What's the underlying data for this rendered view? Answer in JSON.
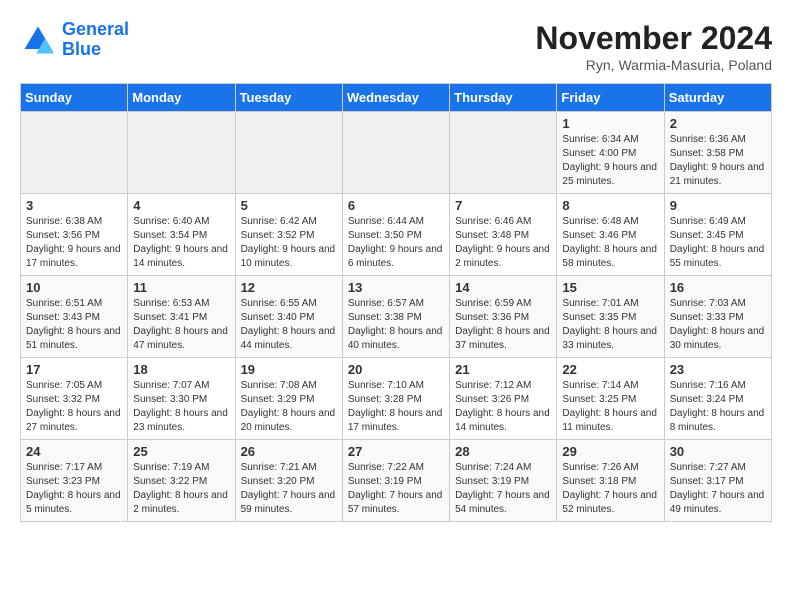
{
  "header": {
    "logo_line1": "General",
    "logo_line2": "Blue",
    "month": "November 2024",
    "location": "Ryn, Warmia-Masuria, Poland"
  },
  "days_of_week": [
    "Sunday",
    "Monday",
    "Tuesday",
    "Wednesday",
    "Thursday",
    "Friday",
    "Saturday"
  ],
  "weeks": [
    [
      {
        "day": "",
        "info": ""
      },
      {
        "day": "",
        "info": ""
      },
      {
        "day": "",
        "info": ""
      },
      {
        "day": "",
        "info": ""
      },
      {
        "day": "",
        "info": ""
      },
      {
        "day": "1",
        "info": "Sunrise: 6:34 AM\nSunset: 4:00 PM\nDaylight: 9 hours and 25 minutes."
      },
      {
        "day": "2",
        "info": "Sunrise: 6:36 AM\nSunset: 3:58 PM\nDaylight: 9 hours and 21 minutes."
      }
    ],
    [
      {
        "day": "3",
        "info": "Sunrise: 6:38 AM\nSunset: 3:56 PM\nDaylight: 9 hours and 17 minutes."
      },
      {
        "day": "4",
        "info": "Sunrise: 6:40 AM\nSunset: 3:54 PM\nDaylight: 9 hours and 14 minutes."
      },
      {
        "day": "5",
        "info": "Sunrise: 6:42 AM\nSunset: 3:52 PM\nDaylight: 9 hours and 10 minutes."
      },
      {
        "day": "6",
        "info": "Sunrise: 6:44 AM\nSunset: 3:50 PM\nDaylight: 9 hours and 6 minutes."
      },
      {
        "day": "7",
        "info": "Sunrise: 6:46 AM\nSunset: 3:48 PM\nDaylight: 9 hours and 2 minutes."
      },
      {
        "day": "8",
        "info": "Sunrise: 6:48 AM\nSunset: 3:46 PM\nDaylight: 8 hours and 58 minutes."
      },
      {
        "day": "9",
        "info": "Sunrise: 6:49 AM\nSunset: 3:45 PM\nDaylight: 8 hours and 55 minutes."
      }
    ],
    [
      {
        "day": "10",
        "info": "Sunrise: 6:51 AM\nSunset: 3:43 PM\nDaylight: 8 hours and 51 minutes."
      },
      {
        "day": "11",
        "info": "Sunrise: 6:53 AM\nSunset: 3:41 PM\nDaylight: 8 hours and 47 minutes."
      },
      {
        "day": "12",
        "info": "Sunrise: 6:55 AM\nSunset: 3:40 PM\nDaylight: 8 hours and 44 minutes."
      },
      {
        "day": "13",
        "info": "Sunrise: 6:57 AM\nSunset: 3:38 PM\nDaylight: 8 hours and 40 minutes."
      },
      {
        "day": "14",
        "info": "Sunrise: 6:59 AM\nSunset: 3:36 PM\nDaylight: 8 hours and 37 minutes."
      },
      {
        "day": "15",
        "info": "Sunrise: 7:01 AM\nSunset: 3:35 PM\nDaylight: 8 hours and 33 minutes."
      },
      {
        "day": "16",
        "info": "Sunrise: 7:03 AM\nSunset: 3:33 PM\nDaylight: 8 hours and 30 minutes."
      }
    ],
    [
      {
        "day": "17",
        "info": "Sunrise: 7:05 AM\nSunset: 3:32 PM\nDaylight: 8 hours and 27 minutes."
      },
      {
        "day": "18",
        "info": "Sunrise: 7:07 AM\nSunset: 3:30 PM\nDaylight: 8 hours and 23 minutes."
      },
      {
        "day": "19",
        "info": "Sunrise: 7:08 AM\nSunset: 3:29 PM\nDaylight: 8 hours and 20 minutes."
      },
      {
        "day": "20",
        "info": "Sunrise: 7:10 AM\nSunset: 3:28 PM\nDaylight: 8 hours and 17 minutes."
      },
      {
        "day": "21",
        "info": "Sunrise: 7:12 AM\nSunset: 3:26 PM\nDaylight: 8 hours and 14 minutes."
      },
      {
        "day": "22",
        "info": "Sunrise: 7:14 AM\nSunset: 3:25 PM\nDaylight: 8 hours and 11 minutes."
      },
      {
        "day": "23",
        "info": "Sunrise: 7:16 AM\nSunset: 3:24 PM\nDaylight: 8 hours and 8 minutes."
      }
    ],
    [
      {
        "day": "24",
        "info": "Sunrise: 7:17 AM\nSunset: 3:23 PM\nDaylight: 8 hours and 5 minutes."
      },
      {
        "day": "25",
        "info": "Sunrise: 7:19 AM\nSunset: 3:22 PM\nDaylight: 8 hours and 2 minutes."
      },
      {
        "day": "26",
        "info": "Sunrise: 7:21 AM\nSunset: 3:20 PM\nDaylight: 7 hours and 59 minutes."
      },
      {
        "day": "27",
        "info": "Sunrise: 7:22 AM\nSunset: 3:19 PM\nDaylight: 7 hours and 57 minutes."
      },
      {
        "day": "28",
        "info": "Sunrise: 7:24 AM\nSunset: 3:19 PM\nDaylight: 7 hours and 54 minutes."
      },
      {
        "day": "29",
        "info": "Sunrise: 7:26 AM\nSunset: 3:18 PM\nDaylight: 7 hours and 52 minutes."
      },
      {
        "day": "30",
        "info": "Sunrise: 7:27 AM\nSunset: 3:17 PM\nDaylight: 7 hours and 49 minutes."
      }
    ]
  ]
}
